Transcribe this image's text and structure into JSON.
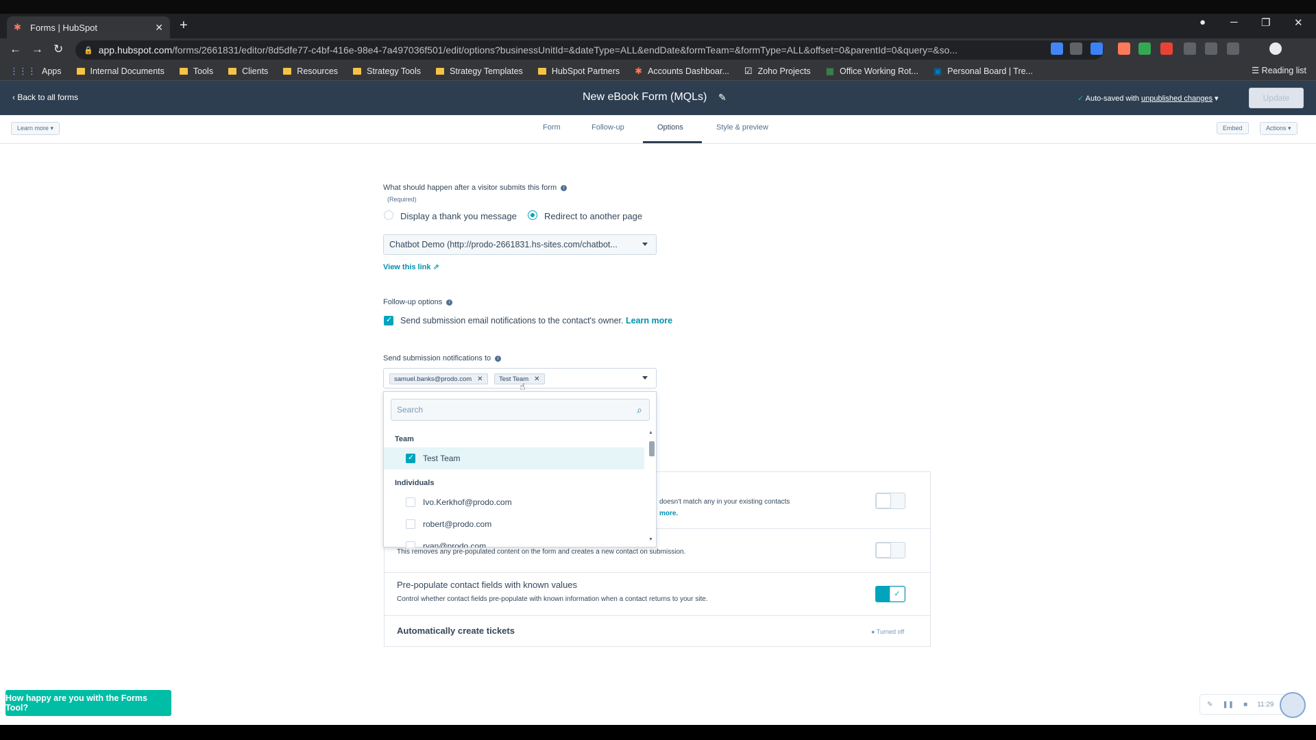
{
  "browser": {
    "tab_title": "Forms | HubSpot",
    "url_host": "app.hubspot.com",
    "url_path": "/forms/2661831/editor/8d5dfe77-c4bf-416e-98e4-7a497036f501/edit/options?businessUnitId=&dateType=ALL&endDate&formTeam=&formType=ALL&offset=0&parentId=0&query=&so...",
    "bookmarks": [
      "Apps",
      "Internal Documents",
      "Tools",
      "Clients",
      "Resources",
      "Strategy Tools",
      "Strategy Templates",
      "HubSpot Partners",
      "Accounts Dashboar...",
      "Zoho Projects",
      "Office Working Rot...",
      "Personal Board | Tre..."
    ],
    "reading_list": "Reading list"
  },
  "header": {
    "back_label": "Back to all forms",
    "form_title": "New eBook Form (MQLs)",
    "autosaved_prefix": "Auto-saved with",
    "autosaved_link": "unpublished changes",
    "update_label": "Update"
  },
  "subnav": {
    "learn_more": "Learn more",
    "tabs": [
      "Form",
      "Follow-up",
      "Options",
      "Style & preview"
    ],
    "active_tab": "Options",
    "embed": "Embed",
    "actions": "Actions"
  },
  "options": {
    "submit_question": "What should happen after a visitor submits this form",
    "required": "(Required)",
    "radio_thank_you": "Display a thank you message",
    "radio_redirect": "Redirect to another page",
    "redirect_value": "Chatbot Demo (http://prodo-2661831.hs-sites.com/chatbot...",
    "view_link": "View this link",
    "followup_label": "Follow-up options",
    "followup_checkbox_text": "Send submission email notifications to the contact's owner.",
    "followup_learn_more": "Learn more",
    "notify_label": "Send submission notifications to",
    "notify_chips": [
      "samuel.banks@prodo.com",
      "Test Team"
    ]
  },
  "dropdown": {
    "search_placeholder": "Search",
    "team_group": "Team",
    "team_items": [
      "Test Team"
    ],
    "individuals_group": "Individuals",
    "individual_items": [
      "Ivo.Kerkhof@prodo.com",
      "robert@prodo.com",
      "ryan@prodo.com"
    ]
  },
  "settings": {
    "row1_desc": "doesn't match any in your existing contacts",
    "row1_link": "more.",
    "row2_desc": "This removes any pre-populated content on the form and creates a new contact on submission.",
    "row3_title": "Pre-populate contact fields with known values",
    "row3_desc": "Control whether contact fields pre-populate with known information when a contact returns to your site.",
    "row4_title": "Automatically create tickets",
    "row4_status": "Turned off"
  },
  "feedback": {
    "label": "How happy are you with the Forms Tool?"
  },
  "recorder": {
    "time": "11:29"
  },
  "colors": {
    "accent": "#00a4bd",
    "header_bg": "#2d3e50",
    "link": "#0091ae",
    "feedback": "#00bda5"
  }
}
